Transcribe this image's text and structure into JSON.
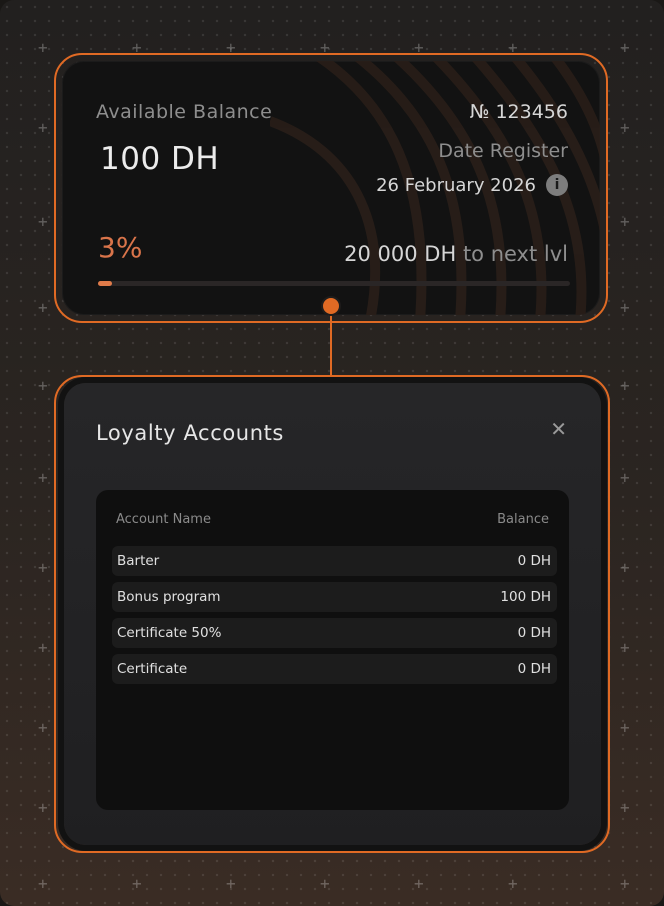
{
  "balance_card": {
    "available_label": "Available Balance",
    "amount": "100 DH",
    "account_number": "№ 123456",
    "date_register_label": "Date Register",
    "date_register_value": "26 February 2026",
    "info_icon": "info-icon",
    "progress_percent_label": "3%",
    "progress_fraction": 0.03,
    "next_level_amount": "20 000 DH",
    "next_level_suffix": " to next lvl"
  },
  "loyalty_modal": {
    "title": "Loyalty Accounts",
    "close_icon": "close-icon",
    "columns": {
      "name": "Account Name",
      "balance": "Balance"
    },
    "rows": [
      {
        "name": "Barter",
        "balance": "0 DH"
      },
      {
        "name": "Bonus program",
        "balance": "100 DH"
      },
      {
        "name": "Certificate 50%",
        "balance": "0 DH"
      },
      {
        "name": "Certificate",
        "balance": "0 DH"
      }
    ]
  },
  "colors": {
    "accent": "#e06a24",
    "percent_text": "#d9744a",
    "card_bg": "#121212",
    "modal_bg": "#262628"
  }
}
